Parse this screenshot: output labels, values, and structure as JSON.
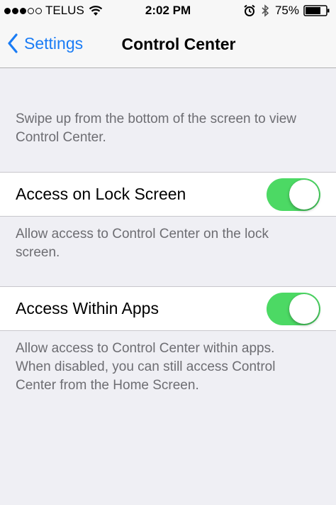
{
  "status_bar": {
    "carrier": "TELUS",
    "time": "2:02 PM",
    "battery_percent": "75%",
    "signal_bars_filled": 3,
    "signal_bars_total": 5,
    "battery_level": 0.75
  },
  "nav": {
    "back_label": "Settings",
    "title": "Control Center"
  },
  "intro_text": "Swipe up from the bottom of the screen to view Control Center.",
  "settings": [
    {
      "label": "Access on Lock Screen",
      "enabled": true,
      "footer": "Allow access to Control Center on the lock screen."
    },
    {
      "label": "Access Within Apps",
      "enabled": true,
      "footer": "Allow access to Control Center within apps. When disabled, you can still access Control Center from the Home Screen."
    }
  ],
  "colors": {
    "accent_blue": "#1a7cf5",
    "switch_on_green": "#4cd964",
    "background": "#efeff4",
    "footer_text": "#6d6d72"
  },
  "icons": [
    "wifi-icon",
    "alarm-icon",
    "bluetooth-icon",
    "battery-icon",
    "back-chevron-icon"
  ]
}
